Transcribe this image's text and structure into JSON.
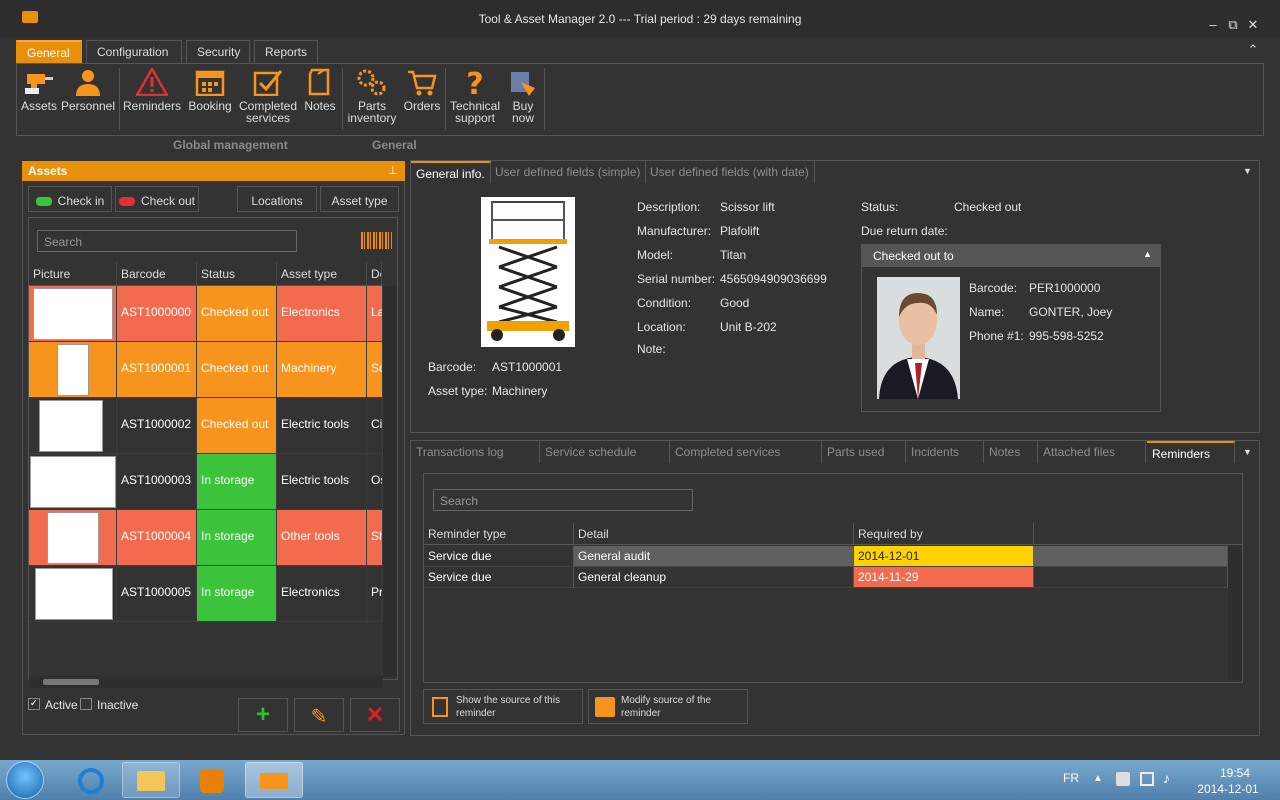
{
  "window": {
    "title": "Tool & Asset Manager 2.0 --- Trial period : 29 days remaining",
    "minimize": "–",
    "maximize": "⧉",
    "close": "✕",
    "collapse": "⌃"
  },
  "ribbon": {
    "tabs": [
      "General",
      "Configuration",
      "Security",
      "Reports"
    ],
    "buttons": [
      {
        "label": "Assets"
      },
      {
        "label": "Personnel"
      },
      {
        "label": "Reminders"
      },
      {
        "label": "Booking"
      },
      {
        "label": "Completed services"
      },
      {
        "label": "Notes"
      },
      {
        "label": "Parts inventory"
      },
      {
        "label": "Orders"
      },
      {
        "label": "Technical support"
      },
      {
        "label": "Buy now"
      }
    ],
    "groups": [
      "Global management",
      "General"
    ]
  },
  "assets_panel": {
    "title": "Assets",
    "pin": "⊥",
    "check_in": "Check in",
    "check_out": "Check out",
    "locations": "Locations",
    "asset_type": "Asset type",
    "search_placeholder": "Search",
    "columns": [
      "Picture",
      "Barcode",
      "Status",
      "Asset type",
      "De"
    ],
    "rows": [
      {
        "barcode": "AST1000000",
        "status": "Checked out",
        "type": "Electronics",
        "desc": "La",
        "row_color": "#f26b4f",
        "status_color": "#f7941d",
        "type_color": "#f26b4f"
      },
      {
        "barcode": "AST1000001",
        "status": "Checked out",
        "type": "Machinery",
        "desc": "Sc",
        "row_color": "#f7941d",
        "status_color": "#f7941d",
        "type_color": "#f7941d"
      },
      {
        "barcode": "AST1000002",
        "status": "Checked out",
        "type": "Electric tools",
        "desc": "Ci",
        "row_color": "#333333",
        "status_color": "#f7941d",
        "type_color": "#333333"
      },
      {
        "barcode": "AST1000003",
        "status": "In storage",
        "type": "Electric tools",
        "desc": "Os",
        "row_color": "#333333",
        "status_color": "#3cc33c",
        "type_color": "#333333"
      },
      {
        "barcode": "AST1000004",
        "status": "In storage",
        "type": "Other tools",
        "desc": "Sh",
        "row_color": "#f26b4f",
        "status_color": "#3cc33c",
        "type_color": "#f26b4f"
      },
      {
        "barcode": "AST1000005",
        "status": "In storage",
        "type": "Electronics",
        "desc": "Pr",
        "row_color": "#333333",
        "status_color": "#3cc33c",
        "type_color": "#333333"
      }
    ],
    "active_label": "Active",
    "inactive_label": "Inactive"
  },
  "detail_tabs": [
    "General info.",
    "User defined fields (simple)",
    "User defined fields (with date)"
  ],
  "general_info": {
    "description_label": "Description:",
    "description": "Scissor lift",
    "manufacturer_label": "Manufacturer:",
    "manufacturer": "Plafolift",
    "model_label": "Model:",
    "model": "Titan",
    "serial_label": "Serial number:",
    "serial": "4565094909036699",
    "condition_label": "Condition:",
    "condition": "Good",
    "location_label": "Location:",
    "location": "Unit B-202",
    "note_label": "Note:",
    "barcode_label": "Barcode:",
    "barcode": "AST1000001",
    "asset_type_label": "Asset type:",
    "asset_type": "Machinery",
    "status_label": "Status:",
    "status": "Checked out",
    "due_label": "Due return date:",
    "checked_out_to": "Checked out to",
    "person_barcode_label": "Barcode:",
    "person_barcode": "PER1000000",
    "person_name_label": "Name:",
    "person_name": "GONTER, Joey",
    "person_phone_label": "Phone #1:",
    "person_phone": "995-598-5252"
  },
  "bottom_tabs": [
    "Transactions log",
    "Service schedule",
    "Completed services",
    "Parts used",
    "Incidents",
    "Notes",
    "Attached files",
    "Reminders"
  ],
  "reminders": {
    "search_placeholder": "Search",
    "columns": [
      "Reminder type",
      "Detail",
      "Required by"
    ],
    "rows": [
      {
        "type": "Service due",
        "detail": "General audit",
        "required": "2014-12-01",
        "required_color": "#ffd200",
        "row_bg": "#606060"
      },
      {
        "type": "Service due",
        "detail": "General cleanup",
        "required": "2014-11-29",
        "required_color": "#f26b4f",
        "row_bg": "#333333"
      }
    ],
    "show_source": "Show the source of this reminder",
    "modify_source": "Modify source of the reminder"
  },
  "taskbar": {
    "lang": "FR",
    "time": "19:54",
    "date": "2014-12-01"
  }
}
